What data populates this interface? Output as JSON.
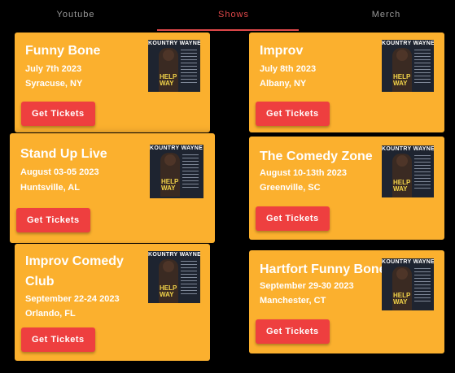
{
  "tabs": [
    {
      "label": "Youtube"
    },
    {
      "label": "Shows"
    },
    {
      "label": "Merch"
    }
  ],
  "active_tab": "Shows",
  "poster": {
    "title": "KOUNTRY WAYNE",
    "subtitle_1": "HELP",
    "subtitle_2": "WAY"
  },
  "shows": [
    {
      "venue": "Funny Bone",
      "date": "July 7th 2023",
      "city": "Syracuse, NY",
      "button": "Get Tickets"
    },
    {
      "venue": "Improv",
      "date": "July 8th 2023",
      "city": "Albany, NY",
      "button": "Get Tickets"
    },
    {
      "venue": "Stand Up Live",
      "date": "August 03-05 2023",
      "city": "Huntsville, AL",
      "button": "Get Tickets"
    },
    {
      "venue": "The Comedy Zone",
      "date": "August 10-13th 2023",
      "city": "Greenville, SC",
      "button": "Get Tickets"
    },
    {
      "venue": "Improv Comedy Club",
      "date": "September 22-24 2023",
      "city": "Orlando, FL",
      "button": "Get Tickets"
    },
    {
      "venue": "Hartfort Funny Bone",
      "date": "September 29-30 2023",
      "city": "Manchester, CT",
      "button": "Get Tickets"
    }
  ],
  "colors": {
    "card": "#fbb02e",
    "button": "#ee3f3f",
    "active_tab": "#e0484a",
    "background": "#000000"
  }
}
